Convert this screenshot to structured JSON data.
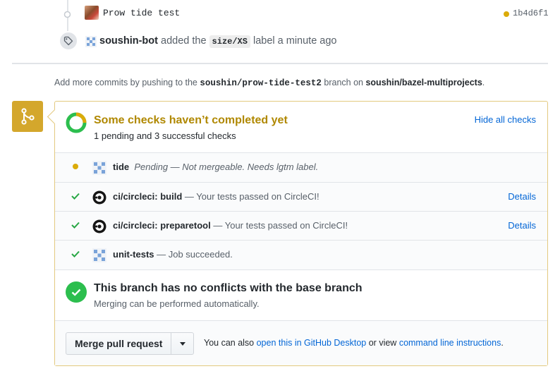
{
  "commit": {
    "message": "Prow tide test",
    "sha": "1b4d6f1",
    "status_color": "#dbab09"
  },
  "label_event": {
    "actor": "soushin-bot",
    "action": "added the",
    "label": "size/XS",
    "suffix": "label a minute ago",
    "icon": "tag-icon"
  },
  "push_note": {
    "prefix": "Add more commits by pushing to the",
    "branch": "soushin/prow-tide-test2",
    "middle": "branch on",
    "repo": "soushin/bazel-multiprojects",
    "suffix": "."
  },
  "checks": {
    "title": "Some checks haven’t completed yet",
    "summary": "1 pending and 3 successful checks",
    "hide_label": "Hide all checks",
    "items": [
      {
        "status": "pending",
        "name": "tide",
        "desc": "Pending — Not mergeable. Needs lgtm label.",
        "details": ""
      },
      {
        "status": "success",
        "name": "ci/circleci: build",
        "desc": "— Your tests passed on CircleCI!",
        "details": "Details"
      },
      {
        "status": "success",
        "name": "ci/circleci: preparetool",
        "desc": "— Your tests passed on CircleCI!",
        "details": "Details"
      },
      {
        "status": "success",
        "name": "unit-tests",
        "desc": "— Job succeeded.",
        "details": ""
      }
    ]
  },
  "conflicts": {
    "title": "This branch has no conflicts with the base branch",
    "subtitle": "Merging can be performed automatically."
  },
  "merge": {
    "button_label": "Merge pull request",
    "also_prefix": "You can also",
    "desktop_link": "open this in GitHub Desktop",
    "or_view": "or view",
    "cli_link": "command line instructions",
    "suffix": "."
  },
  "colors": {
    "pending": "#dbab09",
    "success": "#28a745",
    "link": "#0366d6",
    "merge_icon_bg": "#d4a72c"
  }
}
